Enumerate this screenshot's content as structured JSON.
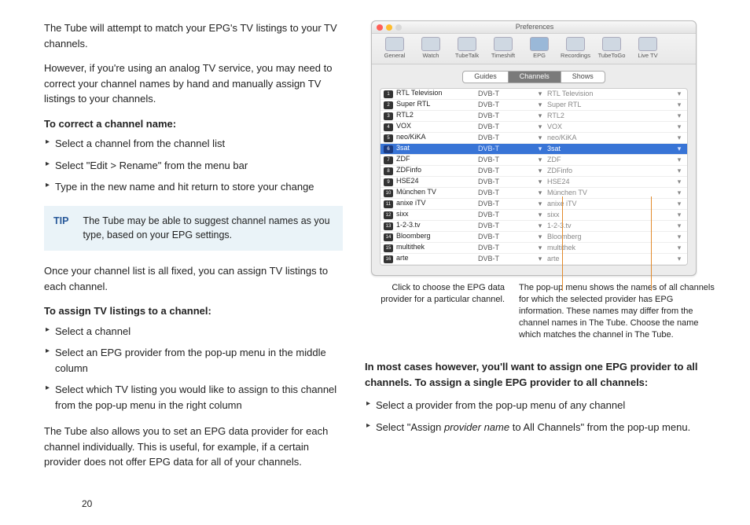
{
  "left": {
    "p1": "The Tube will attempt to match your EPG's TV listings to your TV channels.",
    "p2": "However, if you're using an analog TV service, you may need to correct your channel names by hand and manually assign TV listings to your channels.",
    "h1": "To correct a channel name:",
    "s1": "Select a channel from the channel list",
    "s2": "Select \"Edit > Rename\" from the menu bar",
    "s3": "Type in the new name and hit return to store your change",
    "tip_label": "TIP",
    "tip_body": "The Tube may be able to suggest channel names as you type, based on your EPG settings.",
    "p3": "Once your channel list is all fixed, you can assign TV listings to each channel.",
    "h2": "To assign TV listings to a channel:",
    "s4": "Select a channel",
    "s5": "Select an EPG provider from the pop-up menu in the middle column",
    "s6": "Select which TV listing you would like to assign to this channel from the pop-up menu in the right column",
    "p4": "The Tube also allows you to set an EPG data provider for each channel individually. This is useful, for example, if a certain provider does not offer EPG data for all of your channels."
  },
  "page_number": "20",
  "window": {
    "title": "Preferences",
    "tabs": [
      "General",
      "Watch",
      "TubeTalk",
      "Timeshift",
      "EPG",
      "Recordings",
      "TubeToGo",
      "Live TV"
    ],
    "seg": [
      "Guides",
      "Channels",
      "Shows"
    ],
    "seg_active": "Channels",
    "rows": [
      {
        "n": "1",
        "name": "RTL Television",
        "t": "DVB-T",
        "epg": "RTL Television"
      },
      {
        "n": "2",
        "name": "Super RTL",
        "t": "DVB-T",
        "epg": "Super RTL"
      },
      {
        "n": "3",
        "name": "RTL2",
        "t": "DVB-T",
        "epg": "RTL2"
      },
      {
        "n": "4",
        "name": "VOX",
        "t": "DVB-T",
        "epg": "VOX"
      },
      {
        "n": "5",
        "name": "neo/KiKA",
        "t": "DVB-T",
        "epg": "neo/KiKA"
      },
      {
        "n": "6",
        "name": "3sat",
        "t": "DVB-T",
        "epg": "3sat",
        "sel": true
      },
      {
        "n": "7",
        "name": "ZDF",
        "t": "DVB-T",
        "epg": "ZDF"
      },
      {
        "n": "8",
        "name": "ZDFinfo",
        "t": "DVB-T",
        "epg": "ZDFinfo"
      },
      {
        "n": "9",
        "name": "HSE24",
        "t": "DVB-T",
        "epg": "HSE24"
      },
      {
        "n": "10",
        "name": "München TV",
        "t": "DVB-T",
        "epg": "München TV"
      },
      {
        "n": "11",
        "name": "anixe iTV",
        "t": "DVB-T",
        "epg": "anixe iTV"
      },
      {
        "n": "12",
        "name": "sixx",
        "t": "DVB-T",
        "epg": "sixx"
      },
      {
        "n": "13",
        "name": "1-2-3.tv",
        "t": "DVB-T",
        "epg": "1-2-3.tv"
      },
      {
        "n": "14",
        "name": "Bloomberg",
        "t": "DVB-T",
        "epg": "Bloomberg"
      },
      {
        "n": "15",
        "name": "multithek",
        "t": "DVB-T",
        "epg": "multithek"
      },
      {
        "n": "16",
        "name": "arte",
        "t": "DVB-T",
        "epg": "arte"
      }
    ]
  },
  "callout_left": "Click to choose the EPG data provider for a particular channel.",
  "callout_right": "The pop-up menu shows the names of all channels for which the selected provider has EPG information. These names may differ from the channel names in The Tube. Choose the name which matches the channel in The Tube.",
  "right": {
    "bold1": "In most cases however, you'll want to assign one EPG provider to all channels. To assign a single EPG provider to all channels:",
    "s1": "Select a provider from the pop-up menu of any channel",
    "s2_pre": "Select \"Assign ",
    "s2_it": "provider name",
    "s2_post": " to All Channels\" from the pop-up menu."
  }
}
